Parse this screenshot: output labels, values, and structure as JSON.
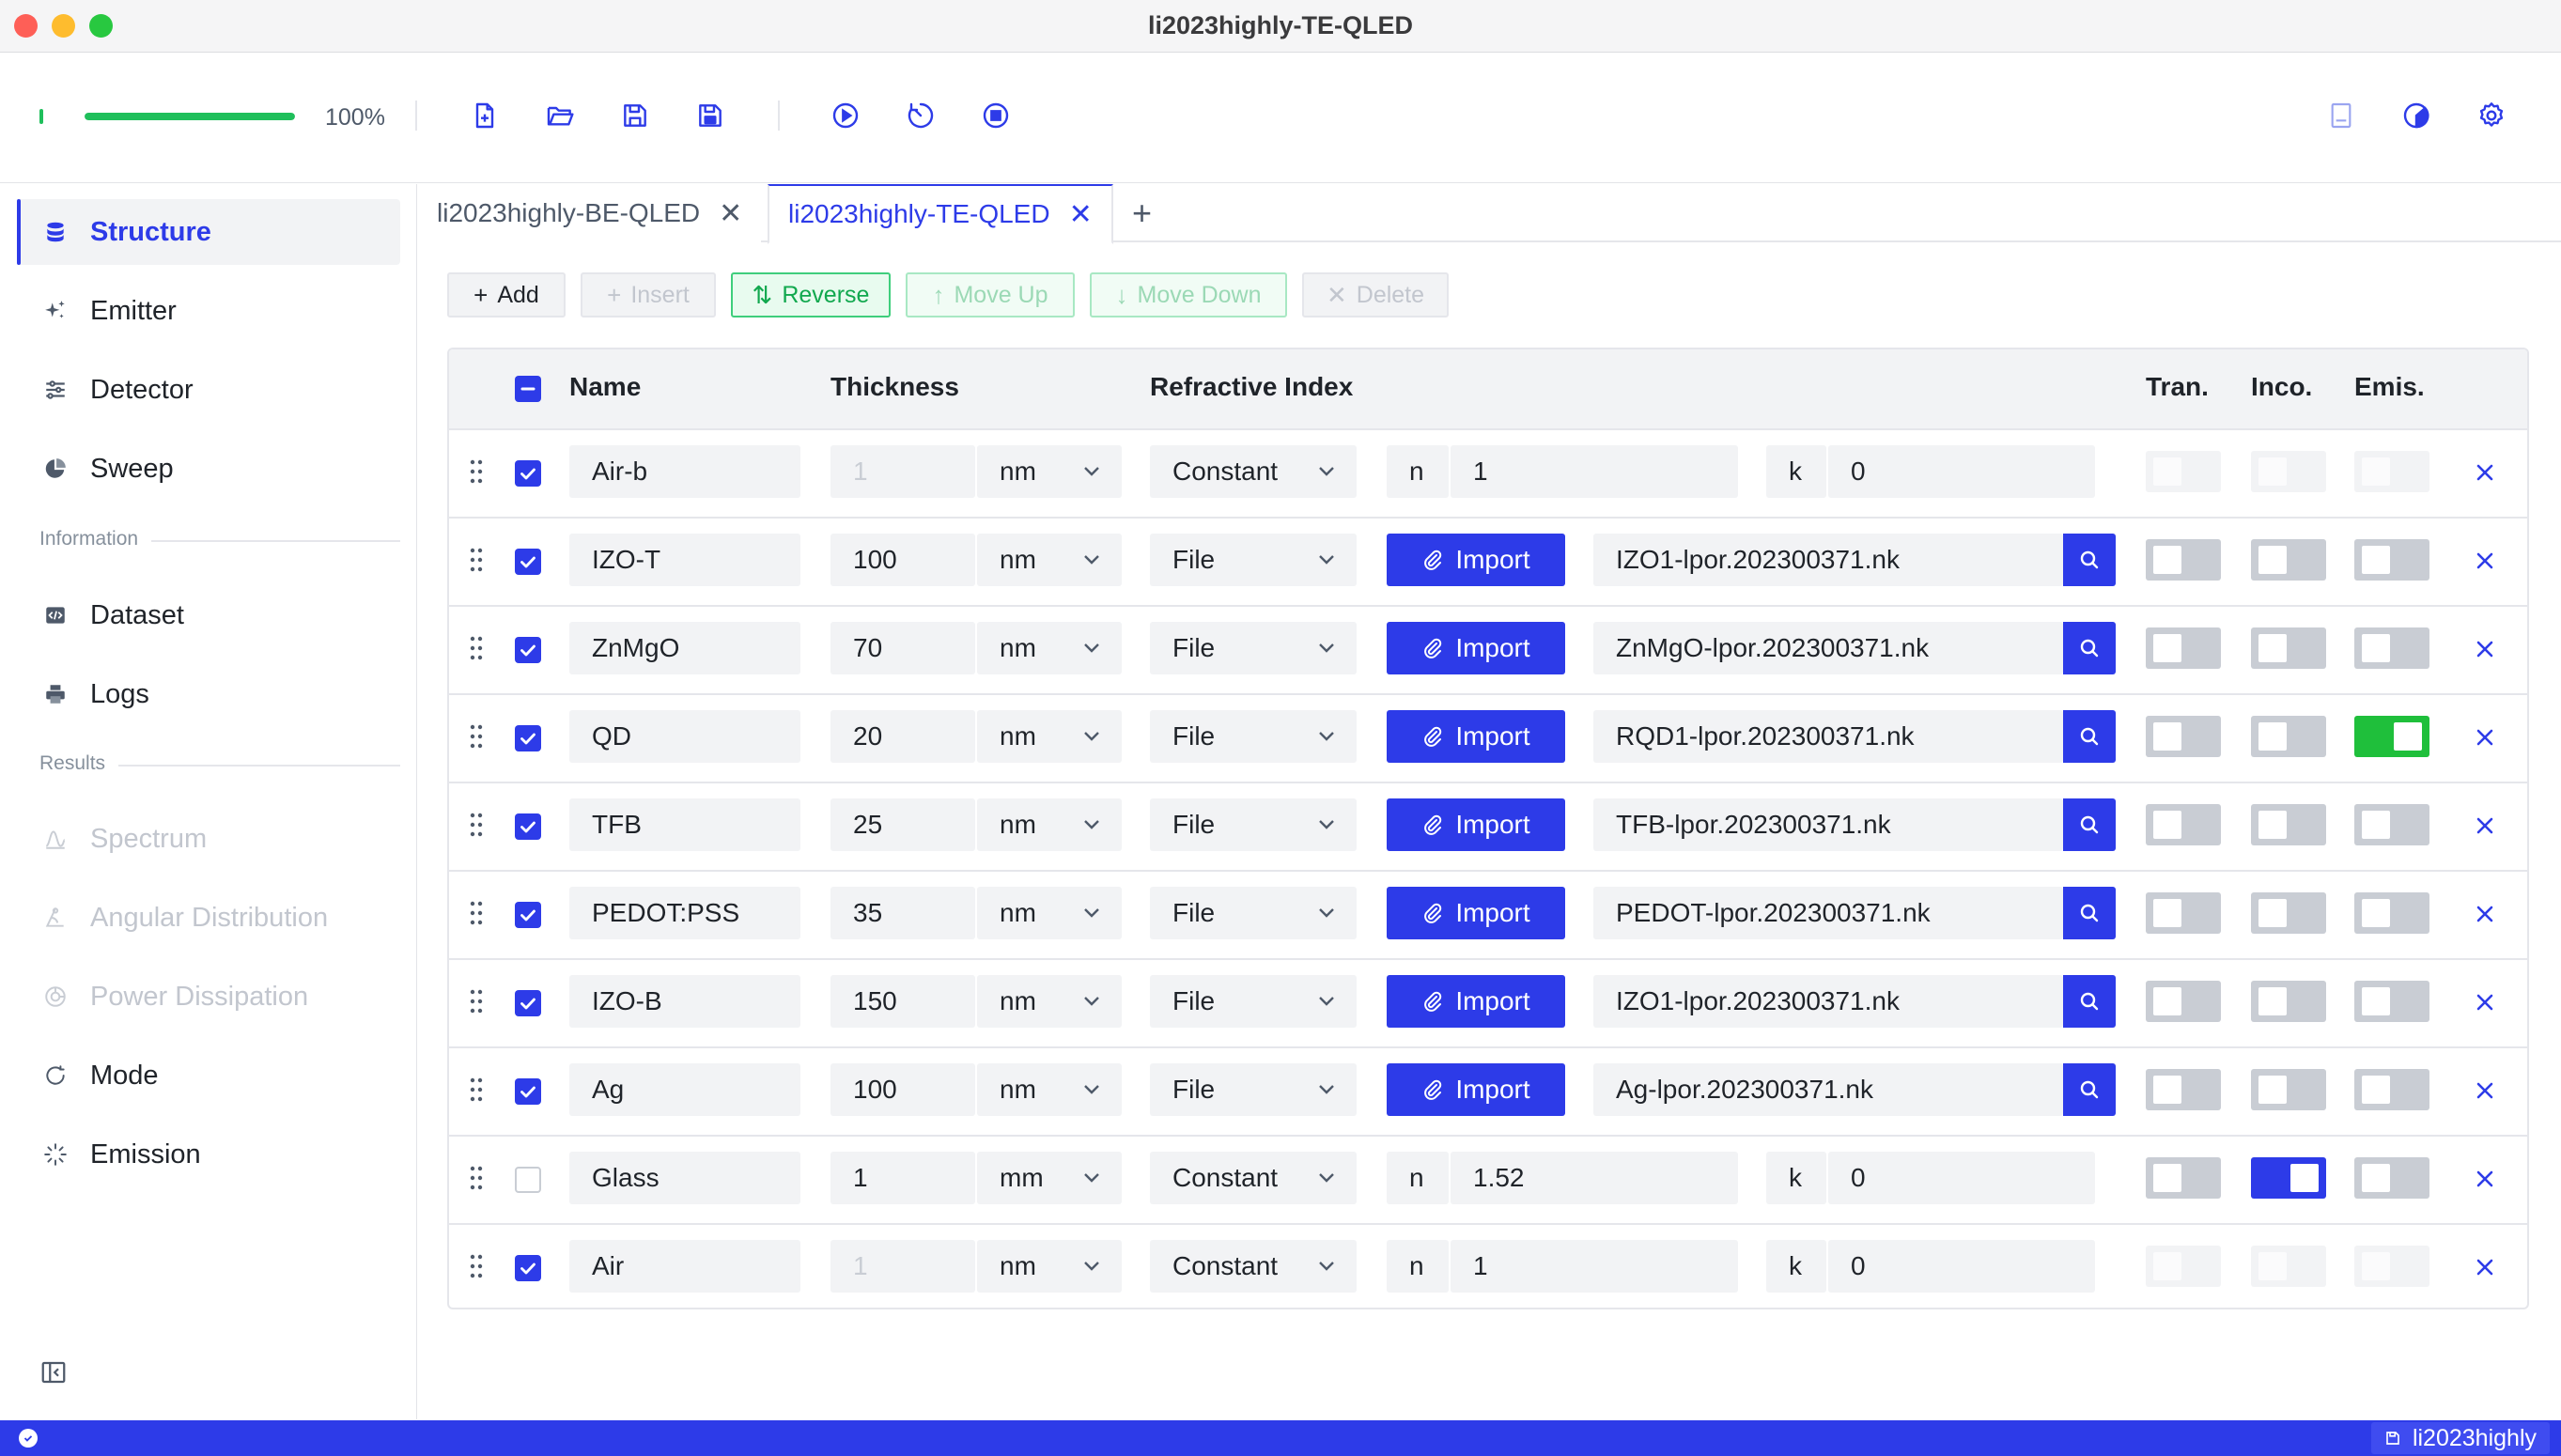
{
  "window": {
    "title": "li2023highly-TE-QLED"
  },
  "toolbar": {
    "progress_value": 100,
    "progress_text": "100%",
    "buttons": [
      "new-file",
      "open-folder",
      "save",
      "save-as",
      "run",
      "timer",
      "stop"
    ],
    "right_buttons": [
      "panel",
      "theme",
      "settings"
    ]
  },
  "sidebar": {
    "items": [
      {
        "label": "Structure",
        "icon": "database-icon",
        "active": true
      },
      {
        "label": "Emitter",
        "icon": "sparkle-icon"
      },
      {
        "label": "Detector",
        "icon": "sliders-icon"
      },
      {
        "label": "Sweep",
        "icon": "pie-icon"
      }
    ],
    "info_section": "Information",
    "info_items": [
      {
        "label": "Dataset",
        "icon": "code-box-icon"
      },
      {
        "label": "Logs",
        "icon": "printer-icon"
      }
    ],
    "results_section": "Results",
    "result_items": [
      {
        "label": "Spectrum",
        "icon": "spectrum-icon",
        "disabled": true
      },
      {
        "label": "Angular Distribution",
        "icon": "angle-icon",
        "disabled": true
      },
      {
        "label": "Power Dissipation",
        "icon": "dissipation-icon",
        "disabled": true
      },
      {
        "label": "Mode",
        "icon": "mode-icon"
      },
      {
        "label": "Emission",
        "icon": "emission-icon"
      }
    ]
  },
  "tabs": [
    {
      "label": "li2023highly-BE-QLED",
      "active": false
    },
    {
      "label": "li2023highly-TE-QLED",
      "active": true
    }
  ],
  "tab_add": "+",
  "actions": {
    "add": "Add",
    "insert": "Insert",
    "reverse": "Reverse",
    "move_up": "Move Up",
    "move_down": "Move Down",
    "delete": "Delete"
  },
  "table": {
    "headers": {
      "name": "Name",
      "thickness": "Thickness",
      "refractive": "Refractive Index",
      "tran": "Tran.",
      "inco": "Inco.",
      "emis": "Emis."
    },
    "import_label": "Import",
    "n_label": "n",
    "k_label": "k",
    "rows": [
      {
        "name": "Air-b",
        "thickness": "1",
        "unit": "nm",
        "mode": "Constant",
        "n": "1",
        "k": "0",
        "checked": true,
        "tran": "disabled",
        "inco": "disabled",
        "emis": "disabled",
        "thickness_dim": true
      },
      {
        "name": "IZO-T",
        "thickness": "100",
        "unit": "nm",
        "mode": "File",
        "file": "IZO1-lpor.202300371.nk",
        "checked": true,
        "tran": "off",
        "inco": "off",
        "emis": "off"
      },
      {
        "name": "ZnMgO",
        "thickness": "70",
        "unit": "nm",
        "mode": "File",
        "file": "ZnMgO-lpor.202300371.nk",
        "checked": true,
        "tran": "off",
        "inco": "off",
        "emis": "off"
      },
      {
        "name": "QD",
        "thickness": "20",
        "unit": "nm",
        "mode": "File",
        "file": "RQD1-lpor.202300371.nk",
        "checked": true,
        "tran": "off",
        "inco": "off",
        "emis": "on-green"
      },
      {
        "name": "TFB",
        "thickness": "25",
        "unit": "nm",
        "mode": "File",
        "file": "TFB-lpor.202300371.nk",
        "checked": true,
        "tran": "off",
        "inco": "off",
        "emis": "off"
      },
      {
        "name": "PEDOT:PSS",
        "thickness": "35",
        "unit": "nm",
        "mode": "File",
        "file": "PEDOT-lpor.202300371.nk",
        "checked": true,
        "tran": "off",
        "inco": "off",
        "emis": "off"
      },
      {
        "name": "IZO-B",
        "thickness": "150",
        "unit": "nm",
        "mode": "File",
        "file": "IZO1-lpor.202300371.nk",
        "checked": true,
        "tran": "off",
        "inco": "off",
        "emis": "off"
      },
      {
        "name": "Ag",
        "thickness": "100",
        "unit": "nm",
        "mode": "File",
        "file": "Ag-lpor.202300371.nk",
        "checked": true,
        "tran": "off",
        "inco": "off",
        "emis": "off"
      },
      {
        "name": "Glass",
        "thickness": "1",
        "unit": "mm",
        "mode": "Constant",
        "n": "1.52",
        "k": "0",
        "checked": false,
        "tran": "off",
        "inco": "on-blue",
        "emis": "off"
      },
      {
        "name": "Air",
        "thickness": "1",
        "unit": "nm",
        "mode": "Constant",
        "n": "1",
        "k": "0",
        "checked": true,
        "tran": "disabled",
        "inco": "disabled",
        "emis": "disabled",
        "thickness_dim": true
      }
    ]
  },
  "statusbar": {
    "project": "li2023highly"
  },
  "colors": {
    "accent": "#2d3be8",
    "success": "#1fbf5b",
    "emis_on": "#1fbf3b"
  }
}
